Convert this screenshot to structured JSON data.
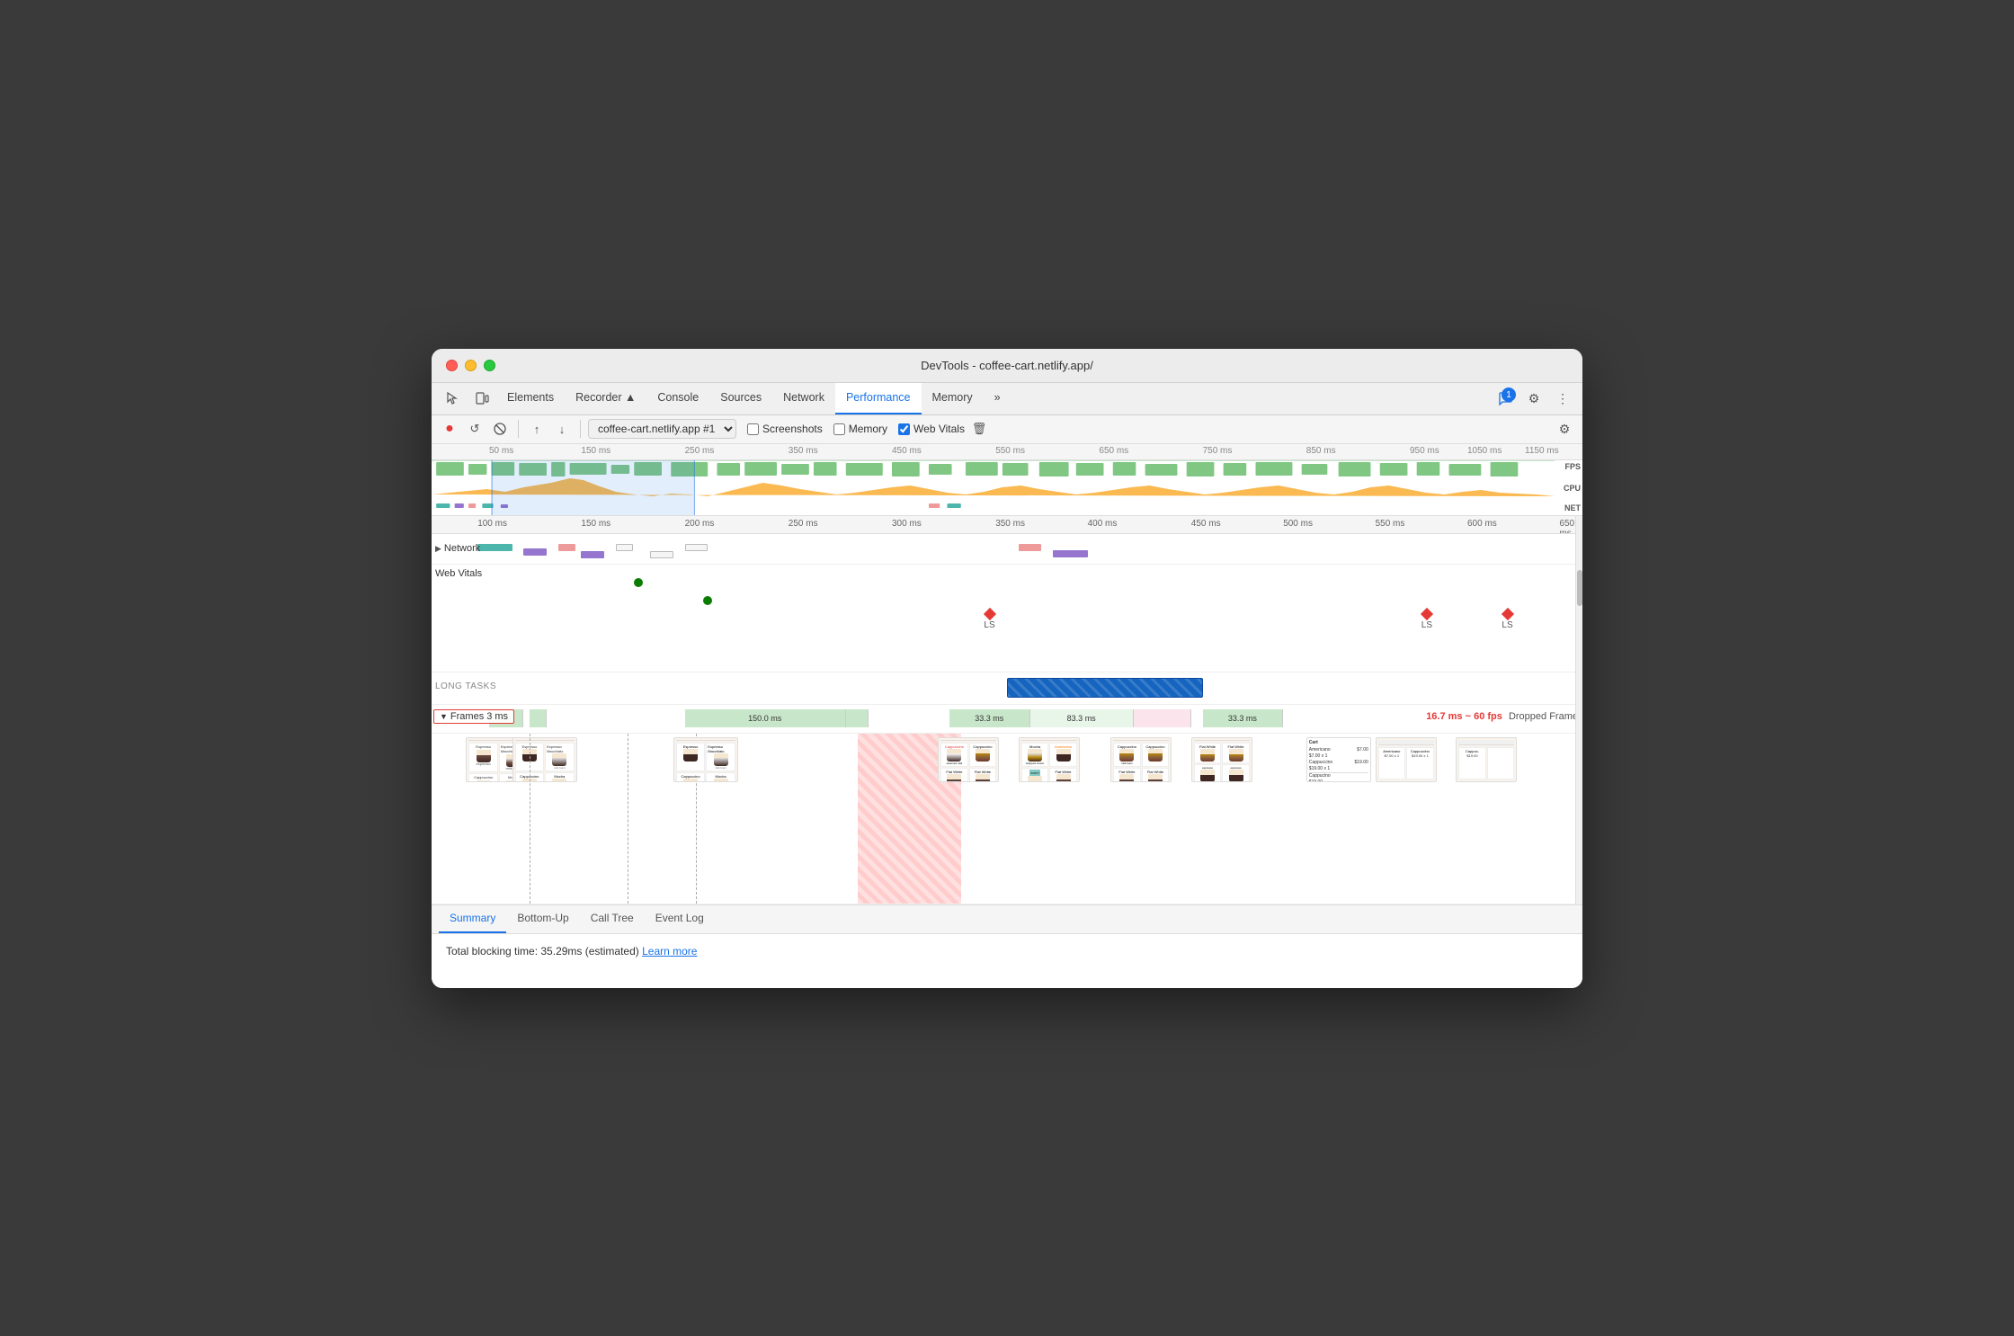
{
  "window": {
    "title": "DevTools - coffee-cart.netlify.app/"
  },
  "tabs": {
    "icons": [
      "cursor-icon",
      "panels-icon"
    ],
    "items": [
      {
        "label": "Elements",
        "active": false
      },
      {
        "label": "Recorder ▲",
        "active": false
      },
      {
        "label": "Console",
        "active": false
      },
      {
        "label": "Sources",
        "active": false
      },
      {
        "label": "Network",
        "active": false
      },
      {
        "label": "Performance",
        "active": true
      },
      {
        "label": "Memory",
        "active": false
      },
      {
        "label": "»",
        "active": false
      }
    ],
    "chat_badge": "1",
    "settings_icon": "⚙",
    "more_icon": "⋮"
  },
  "toolbar": {
    "record_btn": "●",
    "refresh_btn": "↺",
    "clear_btn": "🚫",
    "upload_btn": "↑",
    "download_btn": "↓",
    "profile_select": "coffee-cart.netlify.app #1",
    "screenshots_label": "Screenshots",
    "memory_label": "Memory",
    "webvitals_label": "Web Vitals",
    "delete_icon": "🗑",
    "settings_icon": "⚙"
  },
  "timeline_overview": {
    "ticks": [
      "50 ms",
      "150 ms",
      "250 ms",
      "350 ms",
      "450 ms",
      "550 ms",
      "650 ms",
      "750 ms",
      "850 ms",
      "950 ms",
      "1050 ms",
      "1150 ms"
    ],
    "fps_label": "FPS",
    "cpu_label": "CPU",
    "net_label": "NET"
  },
  "timeline_main": {
    "ticks": [
      "100 ms",
      "150 ms",
      "200 ms",
      "250 ms",
      "300 ms",
      "350 ms",
      "400 ms",
      "450 ms",
      "500 ms",
      "550 ms",
      "600 ms",
      "650 ms"
    ],
    "network_label": "Network",
    "webvitals_label": "Web Vitals",
    "long_tasks_label": "LONG TASKS",
    "frames_label": "Frames",
    "frames_time": "3 ms",
    "frame_segments": [
      {
        "width": "4%",
        "label": "",
        "type": "green"
      },
      {
        "width": "2%",
        "label": "",
        "type": "green"
      },
      {
        "width": "12%",
        "label": "150.0 ms",
        "type": "green"
      },
      {
        "width": "2%",
        "label": "",
        "type": "green"
      },
      {
        "width": "6%",
        "label": "33.3 ms",
        "type": "green"
      },
      {
        "width": "8%",
        "label": "83.3 ms",
        "type": "light-green"
      },
      {
        "width": "4%",
        "label": "",
        "type": "pink"
      },
      {
        "width": "6%",
        "label": "33.3 ms",
        "type": "green"
      }
    ],
    "dropped_frame_text": "16.7 ms ~ 60 fps",
    "dropped_frame_suffix": "Dropped Frame",
    "ls_markers": [
      {
        "label": "LS",
        "left_pct": 49
      },
      {
        "label": "LS",
        "left_pct": 87
      },
      {
        "label": "LS",
        "left_pct": 94
      }
    ]
  },
  "bottom_tabs": [
    {
      "label": "Summary",
      "active": true
    },
    {
      "label": "Bottom-Up",
      "active": false
    },
    {
      "label": "Call Tree",
      "active": false
    },
    {
      "label": "Event Log",
      "active": false
    }
  ],
  "summary": {
    "blocking_time_text": "Total blocking time: 35.29ms (estimated)",
    "learn_more_link": "Learn more"
  },
  "network_items": [
    {
      "color": "#4db6ac",
      "left_pct": 5,
      "width_pct": 3
    },
    {
      "color": "#4db6ac",
      "left_pct": 9,
      "width_pct": 2
    },
    {
      "color": "#ef9a9a",
      "left_pct": 12,
      "width_pct": 2
    },
    {
      "color": "#9575cd",
      "left_pct": 15,
      "width_pct": 3
    },
    {
      "color": "#9575cd",
      "left_pct": 19,
      "width_pct": 2
    },
    {
      "color": "#4db6ac",
      "left_pct": 22,
      "width_pct": 4
    },
    {
      "color": "#ef9a9a",
      "left_pct": 52,
      "width_pct": 3
    },
    {
      "color": "#9575cd",
      "left_pct": 56,
      "width_pct": 4
    }
  ]
}
